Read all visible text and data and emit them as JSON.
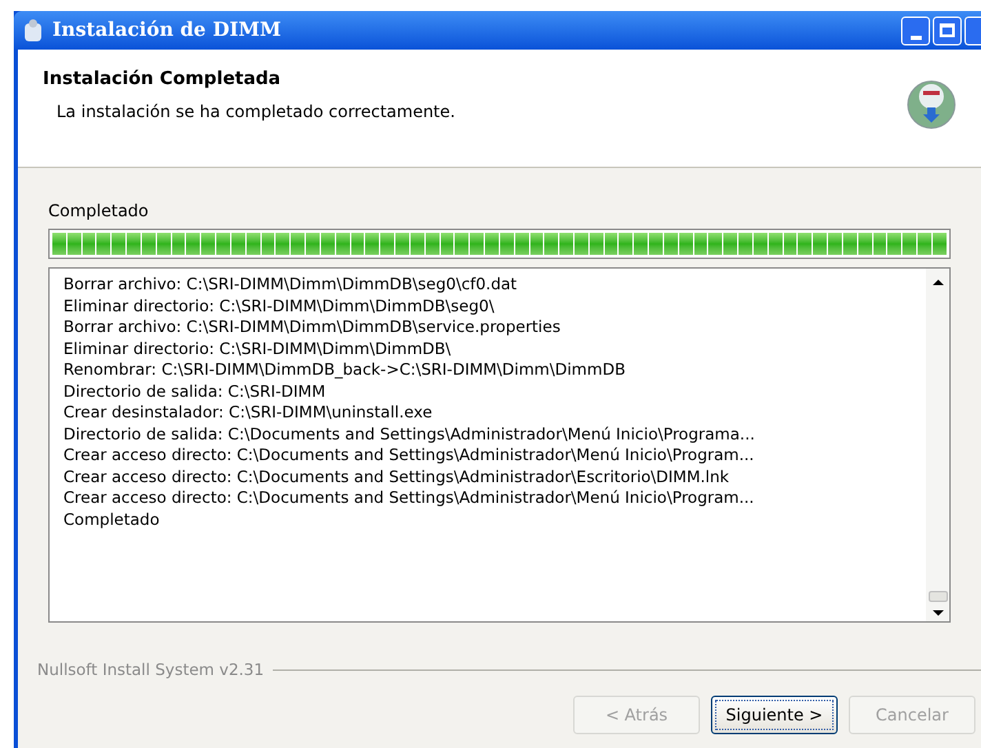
{
  "window": {
    "title": "Instalación de DIMM"
  },
  "header": {
    "title": "Instalación Completada",
    "subtitle": "La instalación se ha completado correctamente."
  },
  "progress": {
    "label": "Completado",
    "level": 1
  },
  "log": [
    "Borrar archivo: C:\\SRI-DIMM\\Dimm\\DimmDB\\seg0\\cf0.dat",
    "Eliminar directorio: C:\\SRI-DIMM\\Dimm\\DimmDB\\seg0\\",
    "Borrar archivo: C:\\SRI-DIMM\\Dimm\\DimmDB\\service.properties",
    "Eliminar directorio: C:\\SRI-DIMM\\Dimm\\DimmDB\\",
    "Renombrar: C:\\SRI-DIMM\\DimmDB_back->C:\\SRI-DIMM\\Dimm\\DimmDB",
    "Directorio de salida: C:\\SRI-DIMM",
    "Crear desinstalador: C:\\SRI-DIMM\\uninstall.exe",
    "Directorio de salida: C:\\Documents and Settings\\Administrador\\Menú Inicio\\Programa...",
    "Crear acceso directo: C:\\Documents and Settings\\Administrador\\Menú Inicio\\Program...",
    "Crear acceso directo: C:\\Documents and Settings\\Administrador\\Escritorio\\DIMM.lnk",
    "Crear acceso directo: C:\\Documents and Settings\\Administrador\\Menú Inicio\\Program...",
    "Completado"
  ],
  "branding": "Nullsoft Install System v2.31",
  "buttons": [
    {
      "label": "< Atrás",
      "disabled": true,
      "default": false
    },
    {
      "label": "Siguiente >",
      "disabled": false,
      "default": true
    },
    {
      "label": "Cancelar",
      "disabled": true,
      "default": false
    }
  ]
}
